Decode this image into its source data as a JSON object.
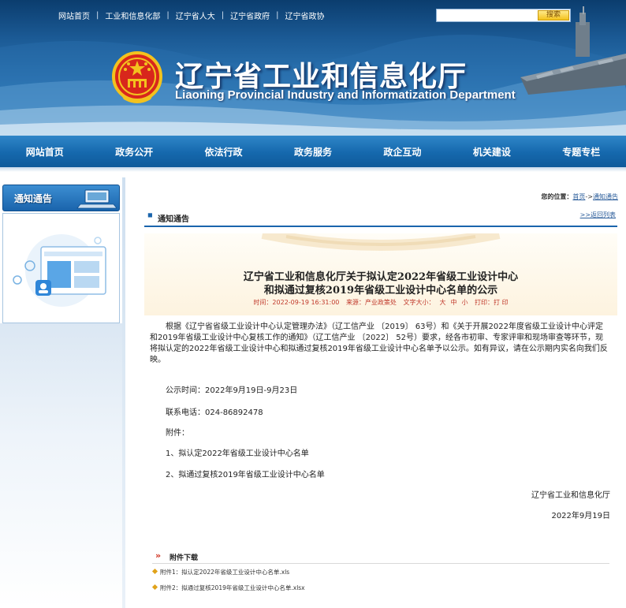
{
  "header": {
    "top_links": [
      "网站首页",
      "工业和信息化部",
      "辽宁省人大",
      "辽宁省政府",
      "辽宁省政协"
    ],
    "search_button": "搜索",
    "site_title_cn": "辽宁省工业和信息化厅",
    "site_title_en": "Liaoning Provincial Industry and Informatization Department"
  },
  "nav": {
    "items": [
      "网站首页",
      "政务公开",
      "依法行政",
      "政务服务",
      "政企互动",
      "机关建设",
      "专题专栏"
    ]
  },
  "sidebar": {
    "title": "通知通告"
  },
  "breadcrumb": {
    "label": "您的位置：",
    "home": "首页",
    "arrow": "->",
    "current": "通知通告"
  },
  "section": {
    "title": "通知通告",
    "return_link": ">>返回列表"
  },
  "article": {
    "title_line1": "辽宁省工业和信息化厅关于拟认定2022年省级工业设计中心",
    "title_line2": "和拟通过复核2019年省级工业设计中心名单的公示",
    "meta_time": "时间：2022-09-19 16:31:00",
    "meta_source": "来源：产业政策处",
    "meta_font_label": "文字大小：",
    "meta_font_sizes": [
      "大",
      "中",
      "小"
    ],
    "meta_print": "打印：打 印",
    "body_paragraph": "根据《辽宁省省级工业设计中心认定管理办法》（辽工信产业 〔2019〕 63号）和《关于开展2022年度省级工业设计中心评定和2019年省级工业设计中心复核工作的通知》（辽工信产业 〔2022〕 52号）要求，经各市初审、专家评审和现场审查等环节，现将拟认定的2022年省级工业设计中心和拟通过复核2019年省级工业设计中心名单予以公示。如有异议，请在公示期内实名向我们反映。",
    "publicity_time": "公示时间：2022年9月19日-9月23日",
    "contact_phone": "联系电话：024-86892478",
    "attachments_label": "附件：",
    "attachment_1": "1、拟认定2022年省级工业设计中心名单",
    "attachment_2": "2、拟通过复核2019年省级工业设计中心名单",
    "signature": "辽宁省工业和信息化厅",
    "date": "2022年9月19日"
  },
  "attachments": {
    "title": "附件下载",
    "items": [
      {
        "label": "附件1：",
        "file": "拟认定2022年省级工业设计中心名单.xls"
      },
      {
        "label": "附件2：",
        "file": "拟通过复核2019年省级工业设计中心名单.xlsx"
      }
    ]
  },
  "colors": {
    "nav_blue": "#1568ad",
    "meta_red": "#c0392b",
    "accent_gold": "#f3c21e"
  }
}
